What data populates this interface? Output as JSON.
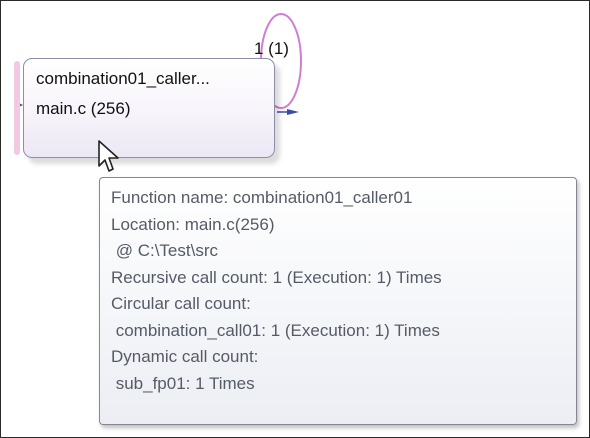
{
  "node": {
    "name": "combination01_caller...",
    "location": "main.c  (256)",
    "recursion_label": "1 (1)"
  },
  "tooltip": {
    "lines": [
      "Function name: combination01_caller01",
      "Location: main.c(256)",
      " @ C:\\Test\\src",
      "Recursive call count: 1 (Execution: 1) Times",
      "Circular call count:",
      " combination_call01: 1 (Execution: 1) Times",
      "Dynamic call count:",
      " sub_fp01: 1 Times"
    ]
  },
  "colors": {
    "recursion_loop": "#d07ed4",
    "edge_arrow": "#3a4aa8",
    "node_border": "#8d8fa8",
    "tooltip_text": "#555b66"
  },
  "icons": {
    "cursor": "mouse-pointer-icon"
  }
}
